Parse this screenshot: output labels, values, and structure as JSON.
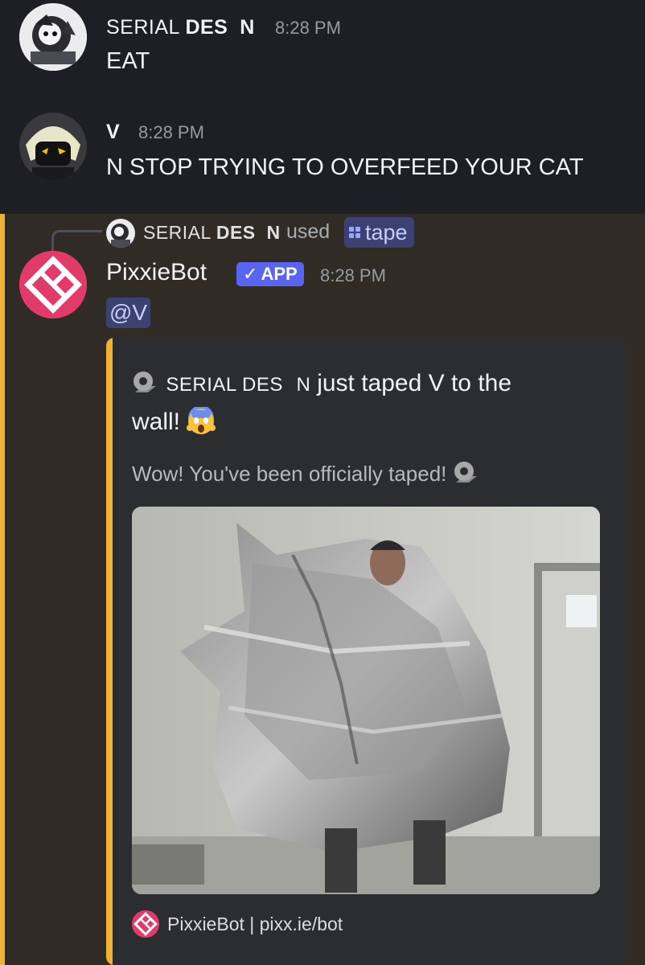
{
  "messages": [
    {
      "username_prefix": "SERIAL ",
      "username_bold": "DES",
      "username_suffix": "N",
      "time": "8:28 PM",
      "text": "EAT"
    },
    {
      "username": "V",
      "time": "8:28 PM",
      "text": "N STOP TRYING TO OVERFEED YOUR CAT"
    }
  ],
  "bot_message": {
    "reply": {
      "user_prefix": "SERIAL ",
      "user_bold": "DES",
      "user_suffix": "N",
      "used_label": "used",
      "command": "tape"
    },
    "bot_name": "PixxieBot",
    "badge": "APP",
    "time": "8:28 PM",
    "mention": "@V",
    "embed": {
      "title_user": "SERIAL DES",
      "title_user_suffix": "N",
      "title_line1_rest": "just taped V to the",
      "title_line2": "wall!",
      "description": "Wow! You've been officially taped!",
      "footer": "PixxieBot | pixx.ie/bot"
    }
  },
  "colors": {
    "background": "#1e1f24",
    "highlight_bg": "#302b25",
    "highlight_accent": "#f0b232",
    "embed_bg": "#2b2d31",
    "blurple": "#5865f2",
    "bot_brand": "#e23b6a"
  },
  "icons": [
    "tape-roll-icon",
    "scream-emoji-icon",
    "pixxiebot-logo-icon",
    "checkmark-icon",
    "slash-command-icon"
  ]
}
